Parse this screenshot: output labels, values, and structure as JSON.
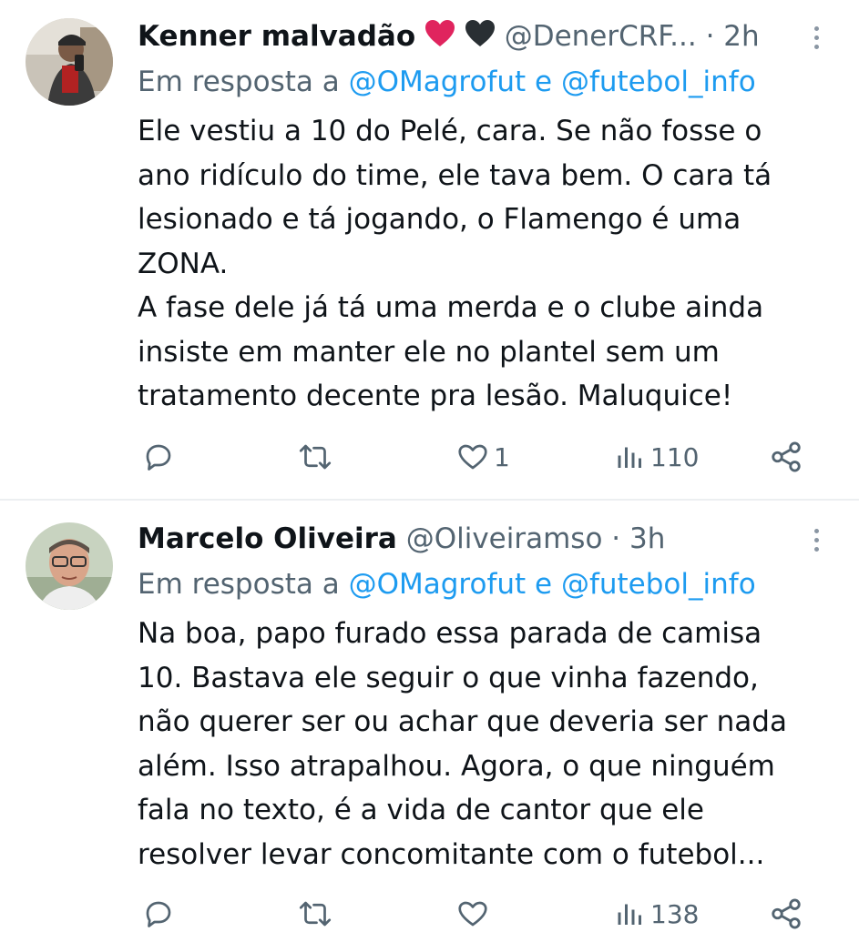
{
  "tweets": [
    {
      "display_name": "Kenner malvadão",
      "emojis": [
        "red-heart",
        "black-heart"
      ],
      "handle": "@DenerCRF...",
      "time": "· 2h",
      "reply_prefix": "Em resposta a",
      "reply_mention_1": "@OMagrofut",
      "reply_and": "e",
      "reply_mention_2": "@futebol_info",
      "text": "Ele vestiu a 10 do Pelé, cara. Se não fosse o\nano ridículo do time, ele tava bem. O cara tá\nlesionado e tá jogando, o Flamengo é uma\nZONA.\nA fase dele já tá uma merda e o clube ainda\ninsiste em manter ele no plantel sem um\ntratamento decente pra lesão. Maluquice!",
      "actions": {
        "reply": "",
        "retweet": "",
        "like": "1",
        "views": "110"
      },
      "icons": [
        "reply-icon",
        "retweet-icon",
        "like-icon",
        "views-icon",
        "share-icon",
        "more-icon"
      ]
    },
    {
      "display_name": "Marcelo Oliveira",
      "handle": "@Oliveiramso",
      "time": "· 3h",
      "reply_prefix": "Em resposta a",
      "reply_mention_1": "@OMagrofut",
      "reply_and": "e",
      "reply_mention_2": "@futebol_info",
      "text": "Na boa, papo furado essa parada de camisa\n10. Bastava ele seguir o que vinha fazendo,\nnão querer ser ou achar que deveria ser nada\nalém. Isso atrapalhou. Agora, o que ninguém\nfala no texto, é  a vida de cantor que ele\nresolver levar concomitante com o futebol...",
      "actions": {
        "reply": "",
        "retweet": "",
        "like": "",
        "views": "138"
      },
      "icons": [
        "reply-icon",
        "retweet-icon",
        "like-icon",
        "views-icon",
        "share-icon",
        "more-icon"
      ]
    }
  ],
  "colors": {
    "accent": "#1d9bf0",
    "secondary_text": "#536471",
    "text": "#0f1419",
    "heart_red": "#e0245e"
  }
}
